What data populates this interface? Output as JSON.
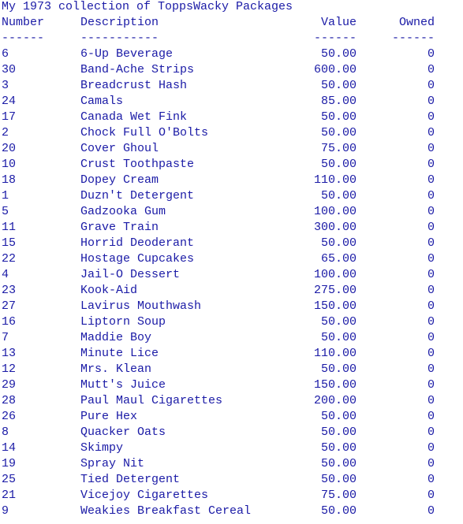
{
  "title": "My 1973 collection of ToppsWacky Packages",
  "columns": {
    "number": "Number",
    "description": "Description",
    "value": "Value",
    "owned": "Owned"
  },
  "separators": {
    "number": "------",
    "description": "-----------",
    "value": "------",
    "owned": "------"
  },
  "rows": [
    {
      "number": "6",
      "description": "6-Up Beverage",
      "value": "50.00",
      "owned": "0"
    },
    {
      "number": "30",
      "description": "Band-Ache Strips",
      "value": "600.00",
      "owned": "0"
    },
    {
      "number": "3",
      "description": "Breadcrust Hash",
      "value": "50.00",
      "owned": "0"
    },
    {
      "number": "24",
      "description": "Camals",
      "value": "85.00",
      "owned": "0"
    },
    {
      "number": "17",
      "description": "Canada Wet Fink",
      "value": "50.00",
      "owned": "0"
    },
    {
      "number": "2",
      "description": "Chock Full O'Bolts",
      "value": "50.00",
      "owned": "0"
    },
    {
      "number": "20",
      "description": "Cover Ghoul",
      "value": "75.00",
      "owned": "0"
    },
    {
      "number": "10",
      "description": "Crust Toothpaste",
      "value": "50.00",
      "owned": "0"
    },
    {
      "number": "18",
      "description": "Dopey Cream",
      "value": "110.00",
      "owned": "0"
    },
    {
      "number": "1",
      "description": "Duzn't Detergent",
      "value": "50.00",
      "owned": "0"
    },
    {
      "number": "5",
      "description": "Gadzooka Gum",
      "value": "100.00",
      "owned": "0"
    },
    {
      "number": "11",
      "description": "Grave Train",
      "value": "300.00",
      "owned": "0"
    },
    {
      "number": "15",
      "description": "Horrid Deoderant",
      "value": "50.00",
      "owned": "0"
    },
    {
      "number": "22",
      "description": "Hostage Cupcakes",
      "value": "65.00",
      "owned": "0"
    },
    {
      "number": "4",
      "description": "Jail-O Dessert",
      "value": "100.00",
      "owned": "0"
    },
    {
      "number": "23",
      "description": "Kook-Aid",
      "value": "275.00",
      "owned": "0"
    },
    {
      "number": "27",
      "description": "Lavirus Mouthwash",
      "value": "150.00",
      "owned": "0"
    },
    {
      "number": "16",
      "description": "Liptorn Soup",
      "value": "50.00",
      "owned": "0"
    },
    {
      "number": "7",
      "description": "Maddie Boy",
      "value": "50.00",
      "owned": "0"
    },
    {
      "number": "13",
      "description": "Minute Lice",
      "value": "110.00",
      "owned": "0"
    },
    {
      "number": "12",
      "description": "Mrs. Klean",
      "value": "50.00",
      "owned": "0"
    },
    {
      "number": "29",
      "description": "Mutt's Juice",
      "value": "150.00",
      "owned": "0"
    },
    {
      "number": "28",
      "description": "Paul Maul Cigarettes",
      "value": "200.00",
      "owned": "0"
    },
    {
      "number": "26",
      "description": "Pure Hex",
      "value": "50.00",
      "owned": "0"
    },
    {
      "number": "8",
      "description": "Quacker Oats",
      "value": "50.00",
      "owned": "0"
    },
    {
      "number": "14",
      "description": "Skimpy",
      "value": "50.00",
      "owned": "0"
    },
    {
      "number": "19",
      "description": "Spray Nit",
      "value": "50.00",
      "owned": "0"
    },
    {
      "number": "25",
      "description": "Tied Detergent",
      "value": "50.00",
      "owned": "0"
    },
    {
      "number": "21",
      "description": "Vicejoy Cigarettes",
      "value": "75.00",
      "owned": "0"
    },
    {
      "number": "9",
      "description": "Weakies Breakfast Cereal",
      "value": "50.00",
      "owned": "0"
    }
  ]
}
